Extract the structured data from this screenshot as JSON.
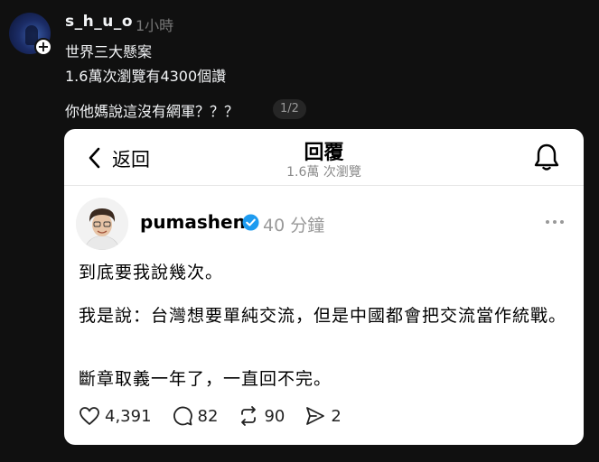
{
  "post": {
    "username": "s_h_u_o",
    "time": "1小時",
    "line1": "世界三大懸案",
    "line2": "1.6萬次瀏覽有4300個讚",
    "line3": "你他媽說這沒有網軍？？？",
    "page_indicator": "1/2"
  },
  "screenshot": {
    "back_label": "返回",
    "title": "回覆",
    "views": "1.6萬 次瀏覽",
    "author": "pumashen",
    "time": "40 分鐘",
    "paragraph1": "到底要我說幾次。",
    "paragraph2": "我是說：台灣想要單純交流，但是中國都會把交流當作統戰。",
    "paragraph3": "斷章取義一年了，一直回不完。",
    "likes": "4,391",
    "comments": "82",
    "reposts": "90",
    "shares": "2"
  },
  "icons": [
    "plus-icon",
    "back-chevron-icon",
    "bell-icon",
    "verified-badge-icon",
    "more-icon",
    "heart-icon",
    "comment-icon",
    "repost-icon",
    "share-icon"
  ],
  "colors": {
    "background": "#101010",
    "card": "#ffffff",
    "verified": "#1d9bf0",
    "muted": "#777777"
  }
}
